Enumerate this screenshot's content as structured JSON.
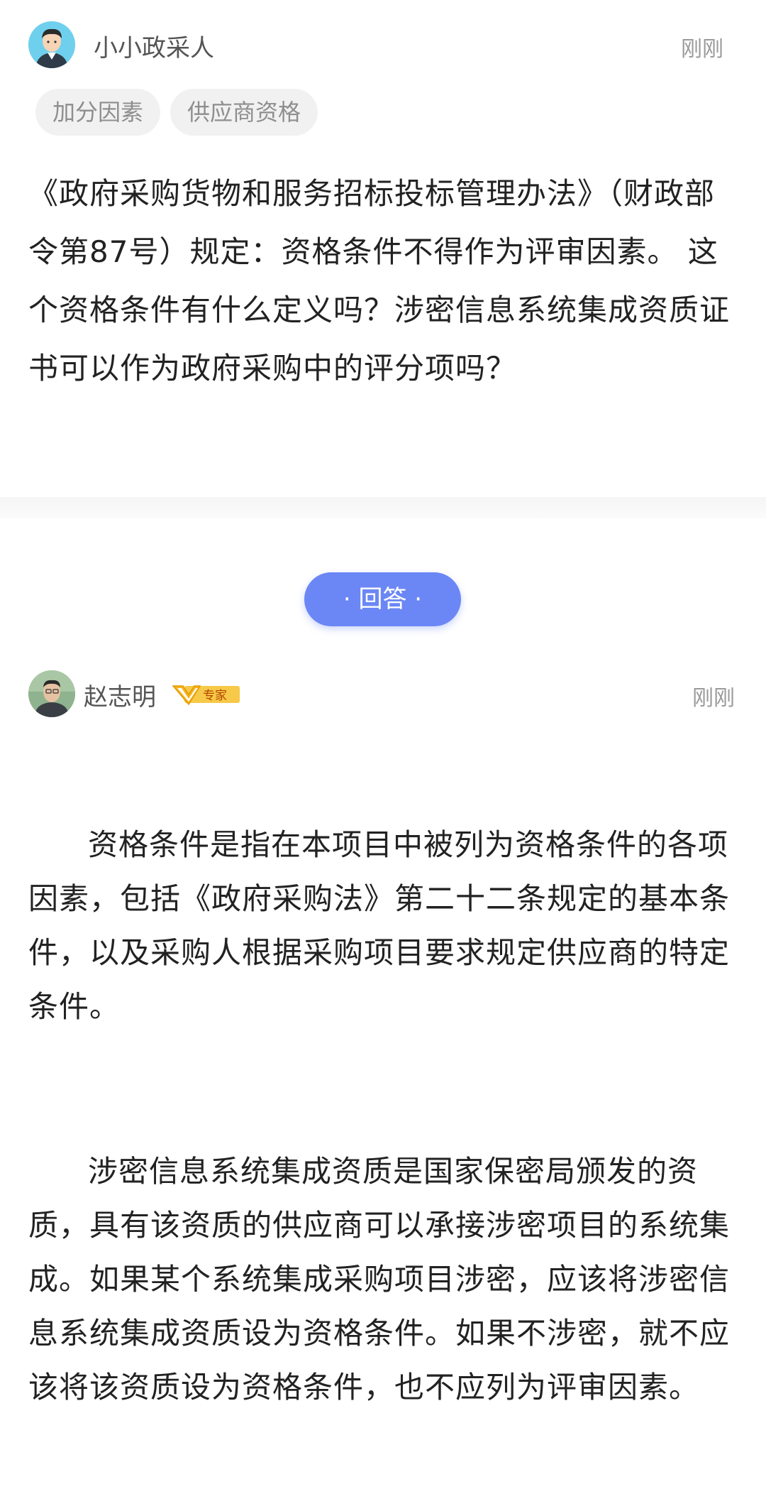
{
  "question": {
    "author": "小小政采人",
    "time": "刚刚",
    "tags": [
      "加分因素",
      "供应商资格"
    ],
    "text": "《政府采购货物和服务招标投标管理办法》（财政部令第87号）规定：资格条件不得作为评审因素。 这个资格条件有什么定义吗？涉密信息系统集成资质证书可以作为政府采购中的评分项吗？"
  },
  "answer_button": {
    "label": "· 回答 ·",
    "color": "#6b87f5"
  },
  "answer": {
    "author": "赵志明",
    "badge": "专家",
    "time": "刚刚",
    "paragraphs": [
      "资格条件是指在本项目中被列为资格条件的各项因素，包括《政府采购法》第二十二条规定的基本条件，以及采购人根据采购项目要求规定供应商的特定条件。",
      "涉密信息系统集成资质是国家保密局颁发的资质，具有该资质的供应商可以承接涉密项目的系统集成。如果某个系统集成采购项目涉密，应该将涉密信息系统集成资质设为资格条件。如果不涉密，就不应该将该资质设为资格条件，也不应列为评审因素。"
    ]
  },
  "icons": {
    "question_avatar": "cartoon-user-avatar-icon",
    "answer_avatar": "user-photo-avatar",
    "badge": "expert-v-badge-icon"
  }
}
